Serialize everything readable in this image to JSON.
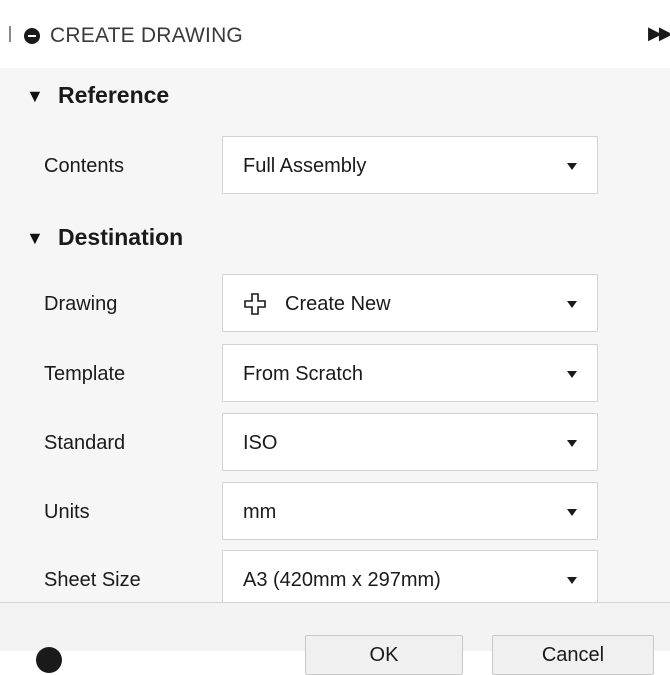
{
  "header": {
    "title": "CREATE DRAWING",
    "icon": "minus-circle-icon",
    "expand_icon": "double-chevron-right-icon"
  },
  "sections": {
    "reference": {
      "title": "Reference"
    },
    "destination": {
      "title": "Destination"
    }
  },
  "fields": {
    "contents": {
      "label": "Contents",
      "value": "Full Assembly"
    },
    "drawing": {
      "label": "Drawing",
      "value": "Create New",
      "icon": "create-new-plus-icon"
    },
    "template": {
      "label": "Template",
      "value": "From Scratch"
    },
    "standard": {
      "label": "Standard",
      "value": "ISO"
    },
    "units": {
      "label": "Units",
      "value": "mm"
    },
    "sheet_size": {
      "label": "Sheet Size",
      "value": "A3 (420mm x 297mm)"
    }
  },
  "footer": {
    "ok_label": "OK",
    "cancel_label": "Cancel"
  },
  "colors": {
    "panel_bg": "#f6f6f6",
    "header_bg": "#ffffff",
    "field_border": "#d2d2d2"
  }
}
